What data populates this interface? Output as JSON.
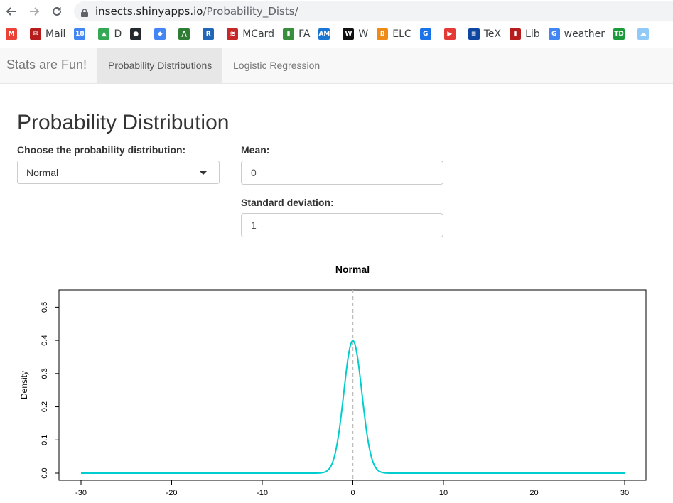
{
  "browser": {
    "url_host": "insects.shinyapps.io",
    "url_path": "/Probability_Dists/",
    "bookmarks": [
      {
        "label": "",
        "icon": "gmail-icon",
        "color": "#ea4335",
        "glyph": "M"
      },
      {
        "label": "Mail",
        "icon": "mail-icon",
        "color": "#b71c1c",
        "glyph": "✉"
      },
      {
        "label": "",
        "icon": "calendar-icon",
        "color": "#4285f4",
        "glyph": "18"
      },
      {
        "label": "D",
        "icon": "drive-icon",
        "color": "#34a853",
        "glyph": "▲"
      },
      {
        "label": "",
        "icon": "github-icon",
        "color": "#24292e",
        "glyph": "●"
      },
      {
        "label": "",
        "icon": "graduation-cap-icon",
        "color": "#4285f4",
        "glyph": "◆"
      },
      {
        "label": "",
        "icon": "analytics-icon",
        "color": "#2e7d32",
        "glyph": "⋀"
      },
      {
        "label": "",
        "icon": "r-icon",
        "color": "#2266b8",
        "glyph": "R"
      },
      {
        "label": "MCard",
        "icon": "bank-icon",
        "color": "#c62828",
        "glyph": "≋"
      },
      {
        "label": "FA",
        "icon": "fa-icon",
        "color": "#388e3c",
        "glyph": "▮"
      },
      {
        "label": "",
        "icon": "amex-icon",
        "color": "#1976d2",
        "glyph": "AM"
      },
      {
        "label": "W",
        "icon": "wikipedia-icon",
        "color": "#111111",
        "glyph": "W"
      },
      {
        "label": "ELC",
        "icon": "elc-icon",
        "color": "#ef8a17",
        "glyph": "B"
      },
      {
        "label": "",
        "icon": "google-classroom-icon",
        "color": "#1a73e8",
        "glyph": "G"
      },
      {
        "label": "",
        "icon": "youtube-icon",
        "color": "#e53935",
        "glyph": "▶"
      },
      {
        "label": "TeX",
        "icon": "tex-icon",
        "color": "#0d47a1",
        "glyph": "≡"
      },
      {
        "label": "Lib",
        "icon": "library-icon",
        "color": "#b71c1c",
        "glyph": "▮"
      },
      {
        "label": "weather",
        "icon": "google-icon",
        "color": "#4285f4",
        "glyph": "G"
      },
      {
        "label": "",
        "icon": "td-icon",
        "color": "#1a9a3a",
        "glyph": "TD"
      },
      {
        "label": "",
        "icon": "cloud-icon",
        "color": "#90caf9",
        "glyph": "☁"
      }
    ]
  },
  "navbar": {
    "brand": "Stats are Fun!",
    "tabs": [
      {
        "label": "Probability Distributions",
        "active": true
      },
      {
        "label": "Logistic Regression",
        "active": false
      }
    ]
  },
  "page": {
    "title": "Probability Distribution",
    "dist_label": "Choose the probability distribution:",
    "dist_value": "Normal",
    "mean_label": "Mean:",
    "mean_value": "0",
    "sd_label": "Standard deviation:",
    "sd_value": "1"
  },
  "chart_data": {
    "type": "line",
    "title": "Normal",
    "xlabel": "",
    "ylabel": "Density",
    "xlim": [
      -30,
      30
    ],
    "ylim": [
      0,
      0.55
    ],
    "x_ticks": [
      -30,
      -20,
      -10,
      0,
      10,
      20,
      30
    ],
    "y_ticks": [
      0.0,
      0.1,
      0.2,
      0.3,
      0.4,
      0.5
    ],
    "y_tick_labels": [
      "0.0",
      "0.1",
      "0.2",
      "0.3",
      "0.4",
      "0.5"
    ],
    "series": [
      {
        "mean": 0,
        "sd": 1,
        "x_range": [
          -30,
          30
        ],
        "color": "#00cdcd"
      }
    ],
    "vline": {
      "x": 0,
      "color": "#bebebe",
      "style": "dashed"
    }
  }
}
